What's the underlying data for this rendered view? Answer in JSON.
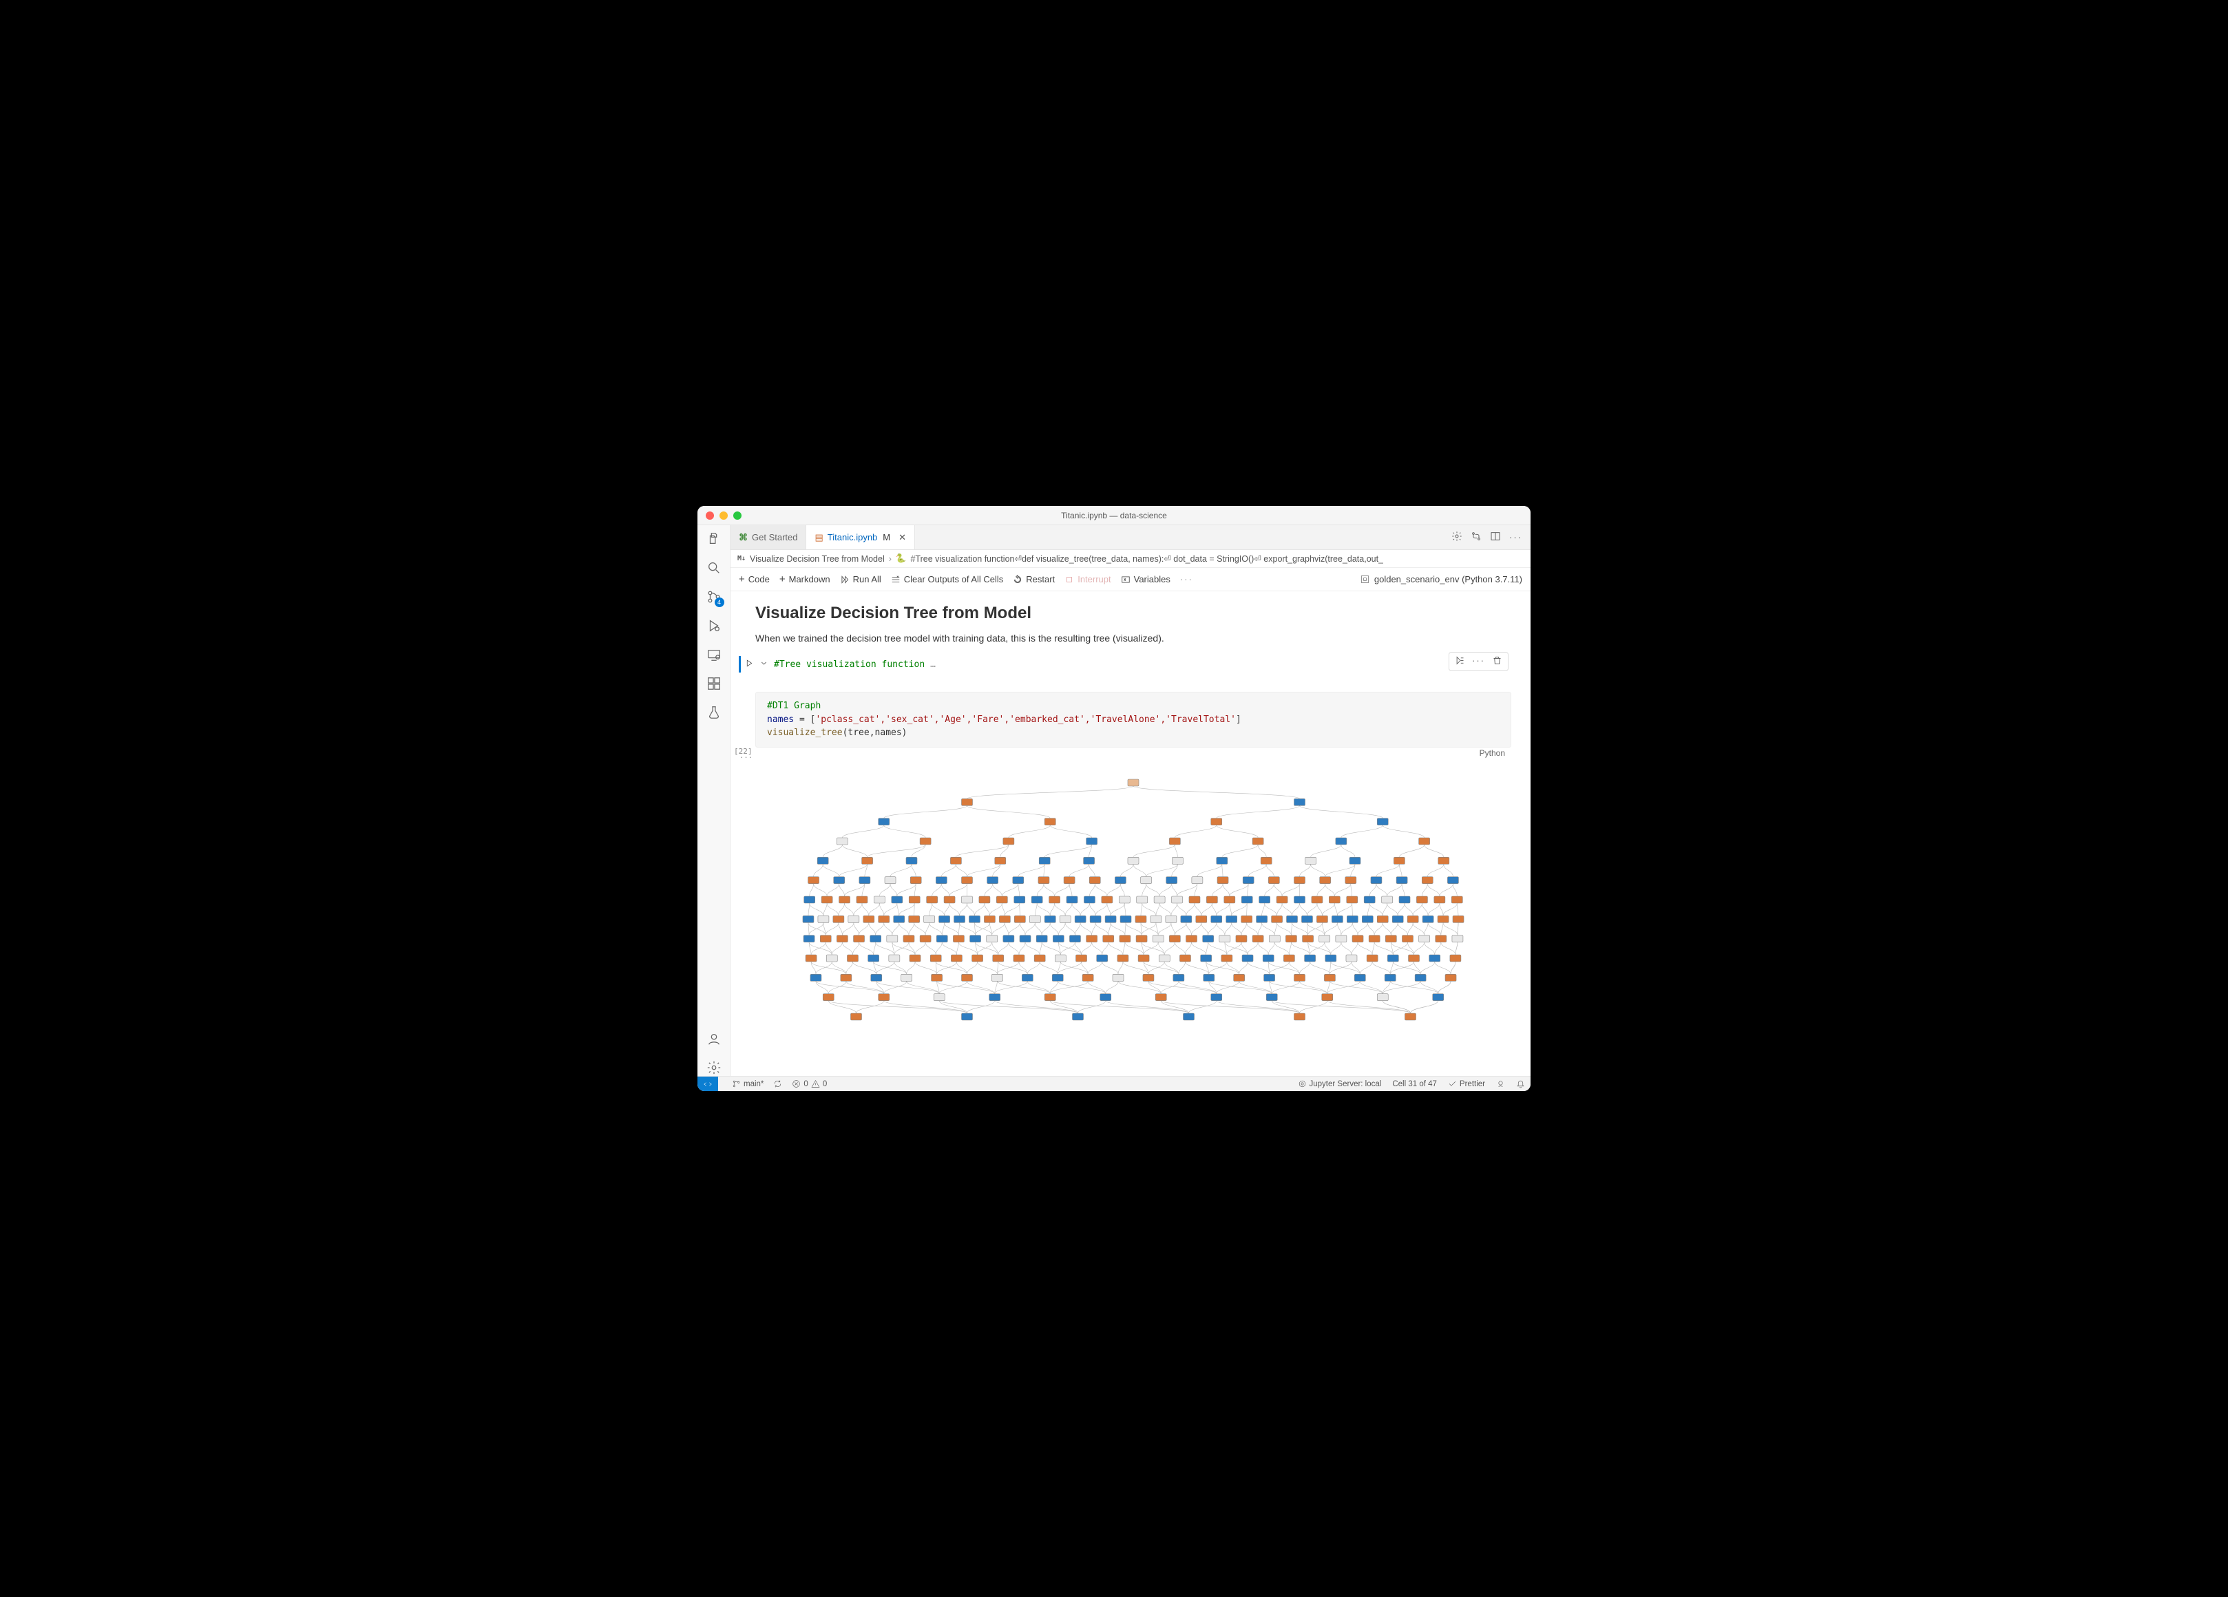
{
  "window_title": "Titanic.ipynb — data-science",
  "tabs": [
    {
      "label": "Get Started",
      "active": false
    },
    {
      "label": "Titanic.ipynb",
      "active": true,
      "modified": "M"
    }
  ],
  "breadcrumb": {
    "md_icon": "M↓",
    "section": "Visualize Decision Tree from Model",
    "cell_summary": "#Tree visualization function⏎def visualize_tree(tree_data, names):⏎    dot_data = StringIO()⏎    export_graphviz(tree_data,out_"
  },
  "nb_toolbar": {
    "code": "Code",
    "markdown": "Markdown",
    "run_all": "Run All",
    "clear": "Clear Outputs of All Cells",
    "restart": "Restart",
    "interrupt": "Interrupt",
    "variables": "Variables",
    "kernel": "golden_scenario_env (Python 3.7.11)"
  },
  "markdown": {
    "heading": "Visualize Decision Tree from Model",
    "body": "When we trained the decision tree model with training data, this is the resulting tree (visualized)."
  },
  "collapsed_cell": {
    "comment": "#Tree visualization function",
    "ellipsis": "…"
  },
  "code_cell": {
    "line1_comment": "#DT1 Graph",
    "line2_prefix": "names = [",
    "line2_items": "'pclass_cat','sex_cat','Age','Fare','embarked_cat','TravelAlone','TravelTotal'",
    "line2_suffix": "]",
    "line3_fn": "visualize_tree",
    "line3_args": "(tree,names)",
    "exec_count": "[22]",
    "language": "Python"
  },
  "source_control_badge": "4",
  "status": {
    "branch": "main*",
    "errors": "0",
    "warnings": "0",
    "jupyter": "Jupyter Server: local",
    "cell_pos": "Cell 31 of 47",
    "formatter": "Prettier"
  },
  "chart_data": {
    "type": "tree",
    "description": "Decision tree graphviz output, binary classification (orange vs blue classes) at varying purity levels",
    "depth_levels": 13,
    "root_color": "orange-light",
    "class_colors": {
      "class0": "#2e7cc0",
      "class1": "#d97a3b",
      "mixed": "#e8e8e8"
    },
    "node_counts_per_level": [
      1,
      2,
      4,
      8,
      15,
      26,
      38,
      44,
      40,
      32,
      22,
      12,
      6
    ],
    "feature_names": [
      "pclass_cat",
      "sex_cat",
      "Age",
      "Fare",
      "embarked_cat",
      "TravelAlone",
      "TravelTotal"
    ]
  }
}
